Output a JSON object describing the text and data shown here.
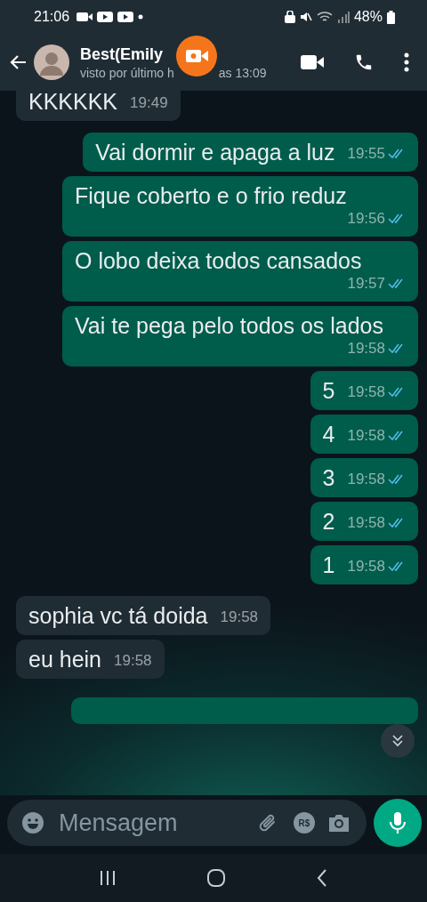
{
  "status_bar": {
    "time": "21:06",
    "battery": "48%"
  },
  "header": {
    "contact_name": "Best(Emily",
    "last_seen_start": "visto por último h",
    "last_seen_end": "as 13:09"
  },
  "messages": [
    {
      "kind": "in",
      "text": "KKKKKK",
      "time": "19:49"
    },
    {
      "kind": "out",
      "text": "Vai dormir e apaga a luz",
      "time": "19:55",
      "read": true
    },
    {
      "kind": "out",
      "text": "Fique coberto e o frio reduz",
      "time": "19:56",
      "read": true
    },
    {
      "kind": "out",
      "text": "O lobo deixa todos cansados",
      "time": "19:57",
      "read": true
    },
    {
      "kind": "out",
      "text": "Vai te pega pelo todos os lados",
      "time": "19:58",
      "read": true
    },
    {
      "kind": "out",
      "text": "5",
      "time": "19:58",
      "read": true
    },
    {
      "kind": "out",
      "text": "4",
      "time": "19:58",
      "read": true
    },
    {
      "kind": "out",
      "text": "3",
      "time": "19:58",
      "read": true
    },
    {
      "kind": "out",
      "text": "2",
      "time": "19:58",
      "read": true
    },
    {
      "kind": "out",
      "text": "1",
      "time": "19:58",
      "read": true
    },
    {
      "kind": "in",
      "text": "sophia vc tá doida",
      "time": "19:58"
    },
    {
      "kind": "in",
      "text": "eu hein",
      "time": "19:58"
    }
  ],
  "composer": {
    "placeholder": "Mensagem",
    "payment_label": "R$"
  }
}
